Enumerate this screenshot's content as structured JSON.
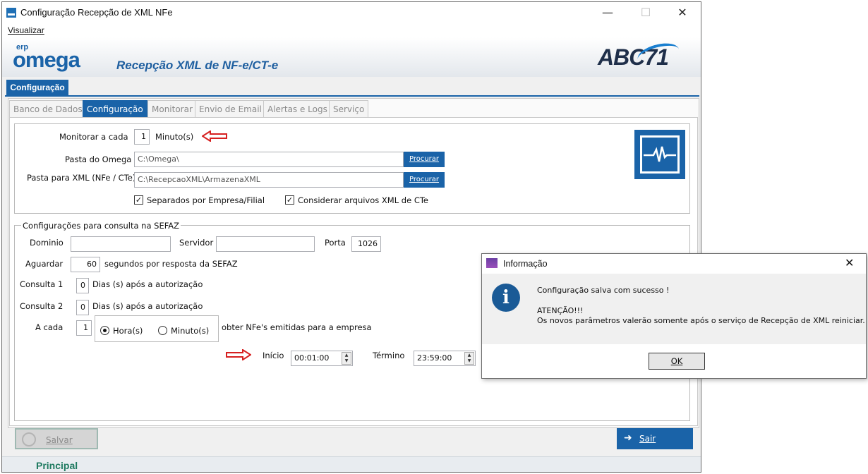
{
  "window": {
    "title": "Configuração Recepção de XML NFe",
    "controls": {
      "minimize": "—",
      "maximize": "☐",
      "close": "✕"
    }
  },
  "menu": {
    "visualizar": "Visualizar"
  },
  "header": {
    "logo_small": "erp",
    "logo_main": "omega",
    "subtitle": "Recepção XML de NF-e/CT-e",
    "brand": "ABC71"
  },
  "ribbon": {
    "tab": "Configuração"
  },
  "tabs": [
    {
      "label": "Banco de Dados",
      "active": false
    },
    {
      "label": "Configuração",
      "active": true
    },
    {
      "label": "Monitorar",
      "active": false
    },
    {
      "label": "Envio de Email",
      "active": false
    },
    {
      "label": "Alertas e Logs",
      "active": false
    },
    {
      "label": "Serviço",
      "active": false
    }
  ],
  "general": {
    "monitor_label": "Monitorar a cada",
    "monitor_value": "1",
    "monitor_unit": "Minuto(s)",
    "pasta_omega_label": "Pasta do Omega",
    "pasta_omega_value": "C:\\Omega\\",
    "pasta_xml_label": "Pasta para XML (NFe / CTe)",
    "pasta_xml_value": "C:\\RecepcaoXML\\ArmazenaXML",
    "procurar_label": "Procurar",
    "separados_label": "Separados por Empresa/Filial",
    "separados_checked": true,
    "considerar_label": "Considerar arquivos XML de CTe",
    "considerar_checked": true
  },
  "sefaz": {
    "group_title": "Configurações para consulta na SEFAZ",
    "dominio_label": "Dominio",
    "dominio_value": "",
    "servidor_label": "Servidor",
    "servidor_value": "",
    "porta_label": "Porta",
    "porta_value": "1026",
    "aguardar_label": "Aguardar",
    "aguardar_value": "60",
    "aguardar_suffix": "segundos por resposta da SEFAZ",
    "consulta1_label": "Consulta 1",
    "consulta1_value": "0",
    "consulta1_suffix": "Dias (s) após a autorização",
    "consulta2_label": "Consulta 2",
    "consulta2_value": "0",
    "consulta2_suffix": "Dias (s) após a autorização",
    "acada_label": "A cada",
    "acada_value": "1",
    "hora_label": "Hora(s)",
    "minuto_label": "Minuto(s)",
    "selected_unit": "Hora(s)",
    "obter_label": "obter NFe's emitidas para a empresa",
    "inicio_label": "Início",
    "inicio_value": "00:01:00",
    "termino_label": "Término",
    "termino_value": "23:59:00"
  },
  "actions": {
    "salvar": "Salvar",
    "sair": "Sair"
  },
  "status": {
    "principal": "Principal"
  },
  "dialog": {
    "title": "Informação",
    "close": "✕",
    "icon": "i",
    "line1": "Configuração salva com sucesso !",
    "line2": "ATENÇÃO!!!",
    "line3": "Os novos parâmetros valerão somente após o serviço de Recepção de XML reiniciar.",
    "ok": "OK"
  },
  "colors": {
    "accent": "#1a63a8",
    "annotation": "#d62020",
    "status_text": "#1f7a60"
  }
}
